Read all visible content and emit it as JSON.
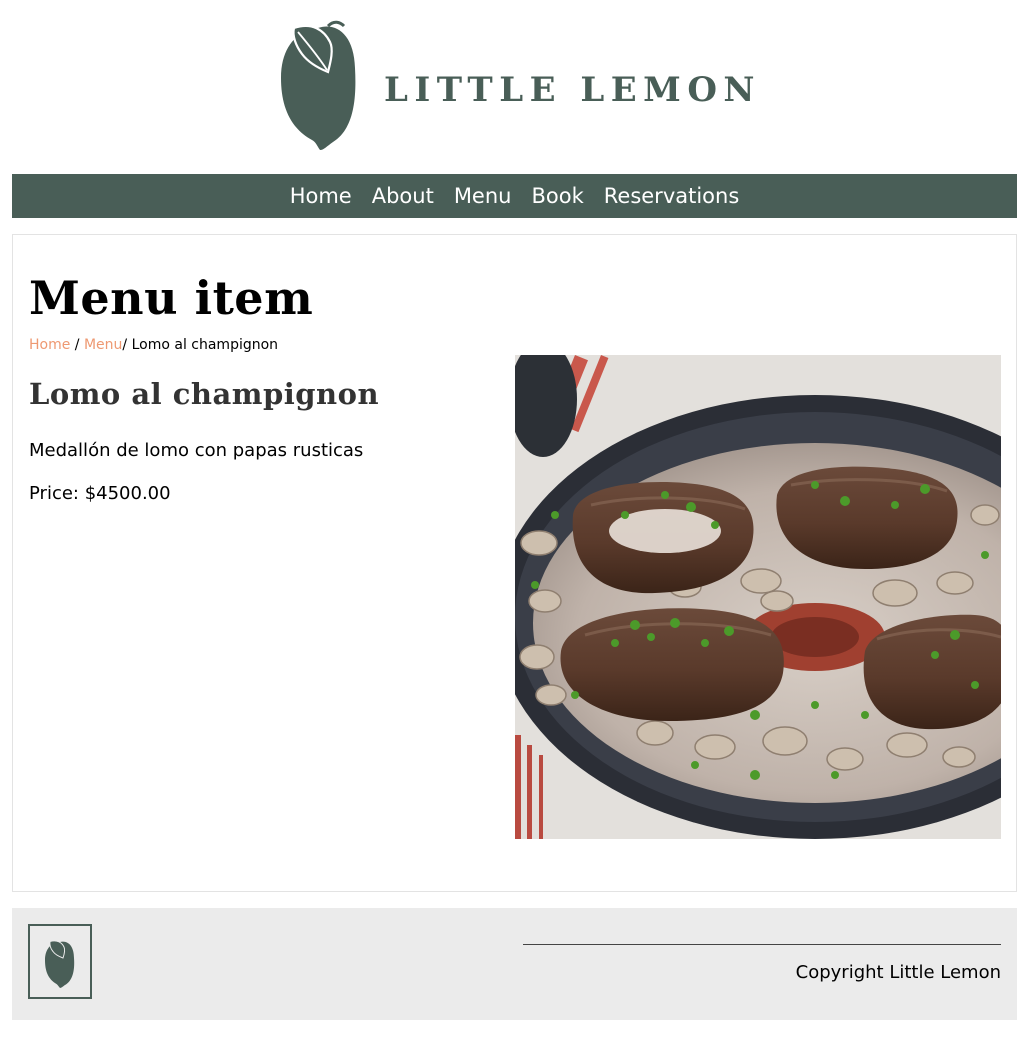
{
  "header": {
    "brand": "LITTLE LEMON",
    "logo_icon": "lemon-icon"
  },
  "nav": {
    "items": [
      {
        "label": "Home"
      },
      {
        "label": "About"
      },
      {
        "label": "Menu"
      },
      {
        "label": "Book"
      },
      {
        "label": "Reservations"
      }
    ]
  },
  "main": {
    "title": "Menu item",
    "breadcrumb": {
      "home": "Home",
      "separator": "/",
      "menu": "Menu",
      "current": "/ Lomo al champignon"
    },
    "item": {
      "name": "Lomo al champignon",
      "description": "Medallón de lomo con papas rusticas",
      "price": "Price: $4500.00",
      "image_subject": "seared beef medallions in mushroom cream sauce in a black skillet"
    }
  },
  "footer": {
    "copyright": "Copyright Little Lemon",
    "logo_icon": "lemon-icon"
  },
  "colors": {
    "brand_green": "#495e57",
    "link_orange": "#ee9972",
    "footer_bg": "#ebebeb",
    "nav_text": "#ffffff"
  }
}
